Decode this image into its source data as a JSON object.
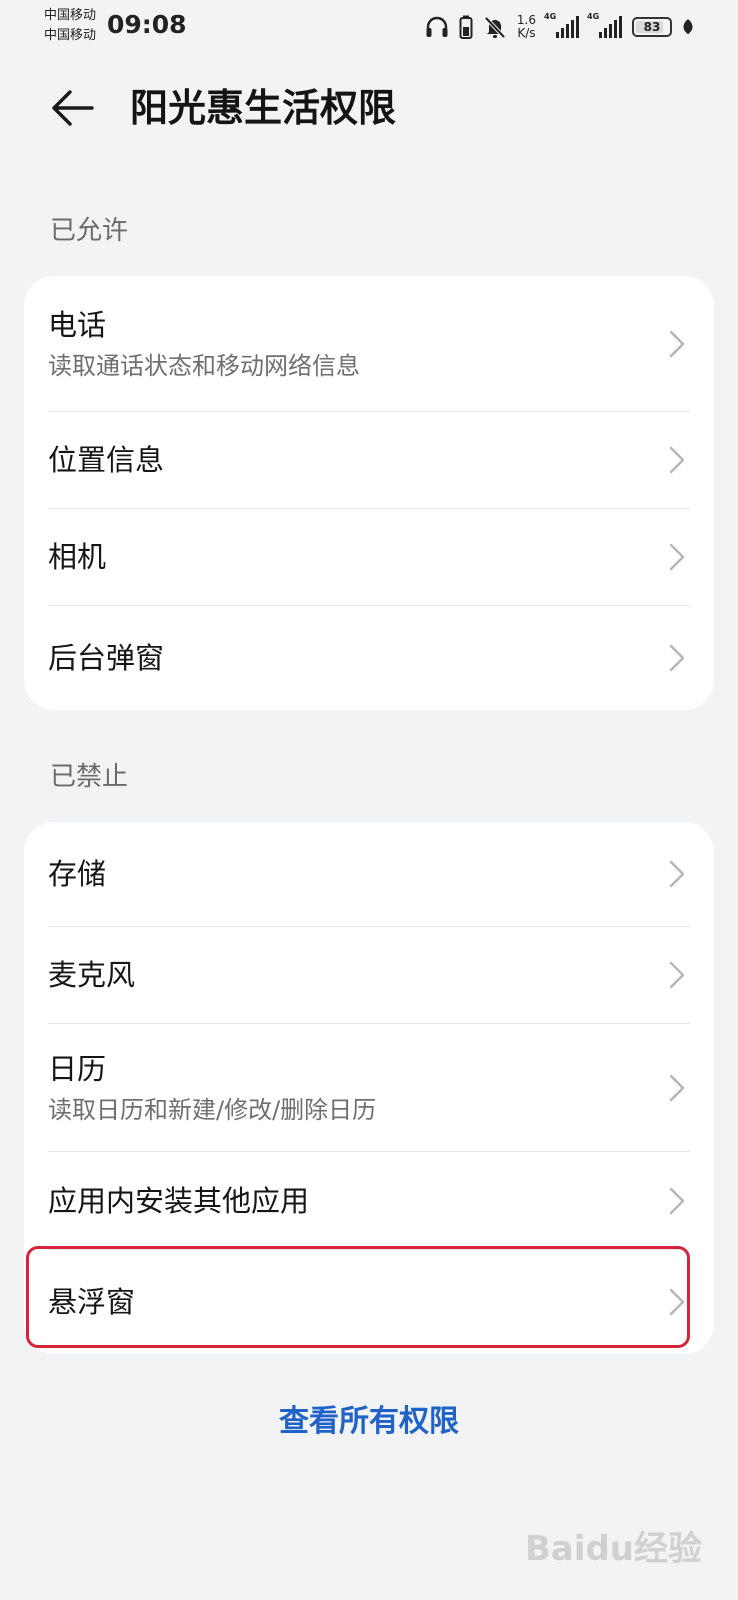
{
  "status_bar": {
    "carrier_1": "中国移动",
    "carrier_2": "中国移动",
    "time": "09:08",
    "speed_value": "1.6",
    "speed_unit": "K/s",
    "network_1": "4G",
    "network_2": "4G",
    "battery": "83",
    "battery_level": 0.83
  },
  "header": {
    "title": "阳光惠生活权限"
  },
  "allowed": {
    "label": "已允许",
    "items": [
      {
        "title": "电话",
        "subtitle": "读取通话状态和移动网络信息"
      },
      {
        "title": "位置信息"
      },
      {
        "title": "相机"
      },
      {
        "title": "后台弹窗"
      }
    ]
  },
  "denied": {
    "label": "已禁止",
    "items": [
      {
        "title": "存储"
      },
      {
        "title": "麦克风"
      },
      {
        "title": "日历",
        "subtitle": "读取日历和新建/修改/删除日历"
      },
      {
        "title": "应用内安装其他应用"
      },
      {
        "title": "悬浮窗"
      }
    ]
  },
  "footer": {
    "view_all": "查看所有权限"
  },
  "watermark": "Baidu经验",
  "colors": {
    "background": "#f1f3f5",
    "card": "#ffffff",
    "link": "#1f62c8",
    "highlight": "#d6243a"
  }
}
